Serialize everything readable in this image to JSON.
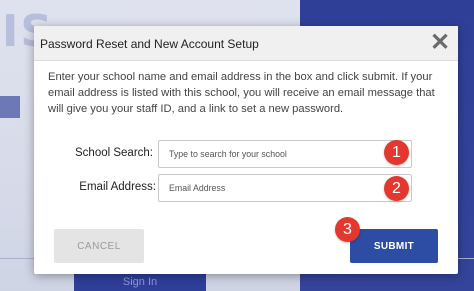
{
  "background": {
    "big_text": "IS",
    "sign_in_label": "Sign In"
  },
  "modal": {
    "title": "Password Reset and New Account Setup",
    "close_icon": "close-icon",
    "description": "Enter your school name and email address in the box and click submit. If your email address is listed with this school, you will receive an email message that will give you your staff ID, and a link to set a new password.",
    "fields": {
      "school_search": {
        "label": "School Search:",
        "placeholder": "Type to search for your school",
        "value": "",
        "icon": "search-icon"
      },
      "email": {
        "label": "Email Address:",
        "placeholder": "Email Address",
        "value": ""
      }
    },
    "buttons": {
      "cancel": "CANCEL",
      "submit": "SUBMIT"
    },
    "step_badges": [
      "1",
      "2",
      "3"
    ]
  },
  "colors": {
    "accent": "#2c4da3",
    "badge": "#e2382f",
    "background_blue": "#2f3f97"
  }
}
